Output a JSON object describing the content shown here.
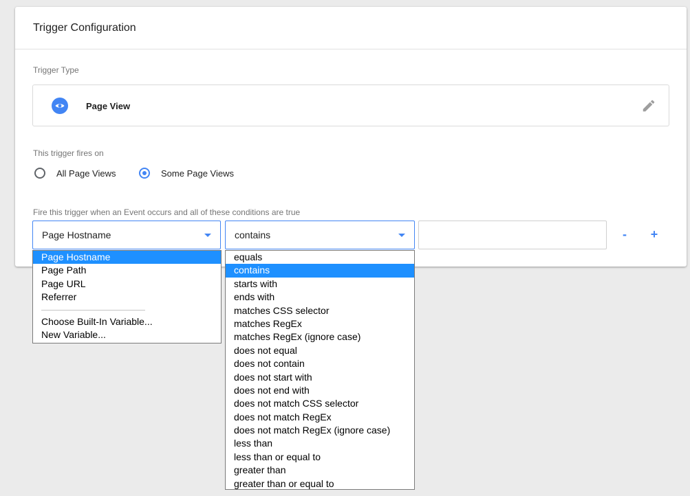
{
  "card": {
    "title": "Trigger Configuration",
    "trigger_type_label": "Trigger Type",
    "trigger_type": {
      "name": "Page View",
      "icon": "eye-icon",
      "edit_icon": "pencil-icon"
    },
    "fires_on_label": "This trigger fires on",
    "radio_options": [
      {
        "label": "All Page Views",
        "checked": false
      },
      {
        "label": "Some Page Views",
        "checked": true
      }
    ],
    "condition_label": "Fire this trigger when an Event occurs and all of these conditions are true",
    "condition": {
      "variable": "Page Hostname",
      "operator": "contains",
      "value": "",
      "remove_label": "-",
      "add_label": "+"
    }
  },
  "variable_dropdown": {
    "items": [
      "Page Hostname",
      "Page Path",
      "Page URL",
      "Referrer"
    ],
    "selected_index": 0,
    "extra_items": [
      "Choose Built-In Variable...",
      "New Variable..."
    ]
  },
  "operator_dropdown": {
    "items": [
      "equals",
      "contains",
      "starts with",
      "ends with",
      "matches CSS selector",
      "matches RegEx",
      "matches RegEx (ignore case)",
      "does not equal",
      "does not contain",
      "does not start with",
      "does not end with",
      "does not match CSS selector",
      "does not match RegEx",
      "does not match RegEx (ignore case)",
      "less than",
      "less than or equal to",
      "greater than",
      "greater than or equal to"
    ],
    "selected_index": 1
  },
  "colors": {
    "accent": "#4285f4",
    "selection": "#1e90ff"
  }
}
